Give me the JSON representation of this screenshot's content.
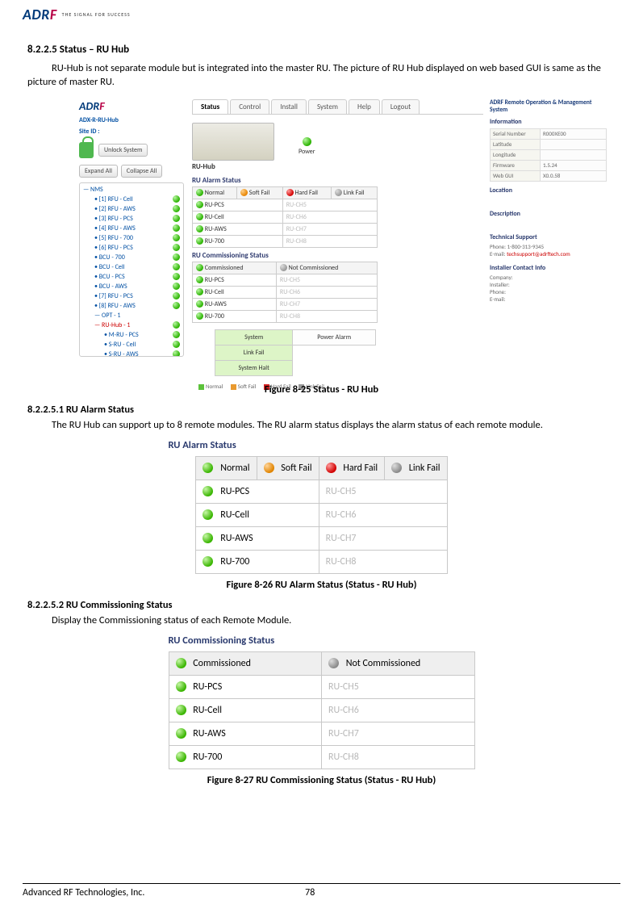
{
  "logo": {
    "text_a": "AD",
    "text_r": "R",
    "text_f": "F",
    "slogan": "THE SIGNAL FOR SUCCESS"
  },
  "h_8225": "8.2.2.5    Status – RU Hub",
  "p_8225": "RU-Hub is not separate module but is integrated into the master RU.  The picture of RU Hub displayed on web based GUI is same as the picture of master RU.",
  "fig25": {
    "left": {
      "link1": "ADX-R-RU-Hub",
      "link2": "Site ID :",
      "unlock": "Unlock System",
      "expand": "Expand All",
      "collapse": "Collapse All",
      "tree": [
        "NMS",
        "[1] RFU - Cell",
        "[2] RFU - AWS",
        "[3] RFU - PCS",
        "[4] RFU - AWS",
        "[5] RFU - 700",
        "[6] RFU - PCS",
        "BCU - 700",
        "BCU - Cell",
        "BCU - PCS",
        "BCU - AWS",
        "[7] RFU - PCS",
        "[8] RFU - AWS",
        "OPT - 1",
        "RU-Hub - 1",
        "M-RU - PCS",
        "S-RU - Cell",
        "S-RU - AWS"
      ]
    },
    "tabs": [
      "Status",
      "Control",
      "Install",
      "System",
      "Help",
      "Logout"
    ],
    "hub_label": "RU-Hub",
    "power_label": "Power",
    "alarm_title": "RU Alarm Status",
    "legend": [
      "Normal",
      "Soft Fail",
      "Hard Fail",
      "Link Fail"
    ],
    "rows_l": [
      "RU-PCS",
      "RU-Cell",
      "RU-AWS",
      "RU-700"
    ],
    "rows_r": [
      "RU-CH5",
      "RU-CH6",
      "RU-CH7",
      "RU-CH8"
    ],
    "comm_title": "RU Commissioning Status",
    "comm_legend": [
      "Commissioned",
      "Not Commissioned"
    ],
    "sb": [
      "System",
      "Power Alarm",
      "Link Fail",
      "System Halt"
    ],
    "tl": [
      "Normal",
      "Soft Fail",
      "Hard Fail",
      "Link Fail"
    ],
    "right": {
      "title": "ADRF Remote Operation & Management System",
      "info_hdr": "Information",
      "rows": [
        [
          "Serial Number",
          "R000XE00"
        ],
        [
          "Latitude",
          ""
        ],
        [
          "Longitude",
          ""
        ],
        [
          "Firmware",
          "1.5.24"
        ],
        [
          "Web GUI",
          "X0.0.58"
        ]
      ],
      "loc": "Location",
      "desc": "Description",
      "ts": "Technical Support",
      "ts_phone": "Phone: 1-800-313-9345",
      "ts_mail_l": "E-mail: ",
      "ts_mail": "techsupport@adrftech.com",
      "ic": "Installer Contact Info",
      "ic_rows": [
        "Company:",
        "Installer:",
        "Phone:",
        "E-mail:"
      ]
    }
  },
  "cap25": "Figure 8-25    Status - RU Hub",
  "h_82251": "8.2.2.5.1    RU Alarm Status",
  "p_82251": "The RU Hub can support up to 8 remote modules. The RU alarm status displays the alarm status of each remote module.",
  "table26": {
    "title": "RU Alarm Status",
    "legend": [
      [
        "green",
        "Normal"
      ],
      [
        "orange",
        "Soft Fail"
      ],
      [
        "red",
        "Hard Fail"
      ],
      [
        "grey",
        "Link Fail"
      ]
    ],
    "rows": [
      [
        "RU-PCS",
        "RU-CH5"
      ],
      [
        "RU-Cell",
        "RU-CH6"
      ],
      [
        "RU-AWS",
        "RU-CH7"
      ],
      [
        "RU-700",
        "RU-CH8"
      ]
    ]
  },
  "cap26": "Figure 8-26    RU Alarm Status (Status - RU Hub)",
  "h_82252": "8.2.2.5.2    RU Commissioning Status",
  "p_82252": "Display the Commissioning status of each Remote Module.",
  "table27": {
    "title": "RU Commissioning Status",
    "legend": [
      [
        "green",
        "Commissioned"
      ],
      [
        "grey",
        "Not Commissioned"
      ]
    ],
    "rows": [
      [
        "RU-PCS",
        "RU-CH5"
      ],
      [
        "RU-Cell",
        "RU-CH6"
      ],
      [
        "RU-AWS",
        "RU-CH7"
      ],
      [
        "RU-700",
        "RU-CH8"
      ]
    ]
  },
  "cap27": "Figure 8-27    RU Commissioning Status (Status - RU Hub)",
  "footer_l": "Advanced RF Technologies, Inc.",
  "footer_r": "78"
}
